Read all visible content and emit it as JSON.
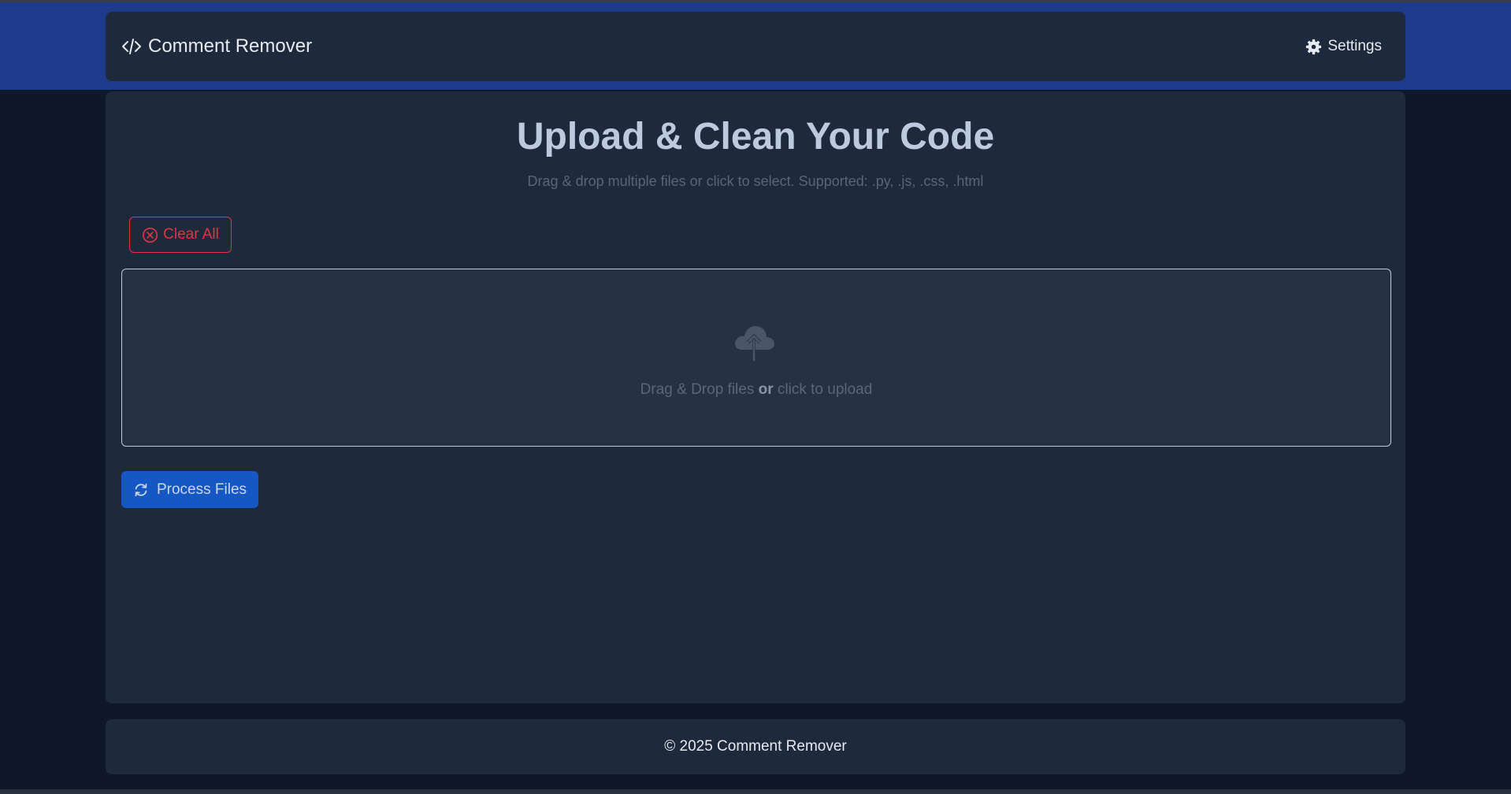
{
  "app": {
    "title": "Comment Remover",
    "settings_label": "Settings",
    "brand_icon": "code-slash-icon",
    "settings_icon": "gear-icon"
  },
  "upload": {
    "heading": "Upload & Clean Your Code",
    "subtitle": "Drag & drop multiple files or click to select. Supported: .py, .js, .css, .html",
    "clear_label": "Clear All",
    "clear_icon": "x-circle-icon",
    "dropzone": {
      "icon": "cloud-upload-icon",
      "text_before": "Drag & Drop files ",
      "text_bold": "or",
      "text_after": " click to upload"
    },
    "process_label": "Process Files",
    "process_icon": "refresh-icon"
  },
  "footer": {
    "text": "© 2025 Comment Remover"
  },
  "colors": {
    "page_bg": "#0f172a",
    "header_band": "#1e3a8a",
    "card_bg": "#1e293b",
    "danger": "#dc3545",
    "primary": "#1558c4"
  }
}
